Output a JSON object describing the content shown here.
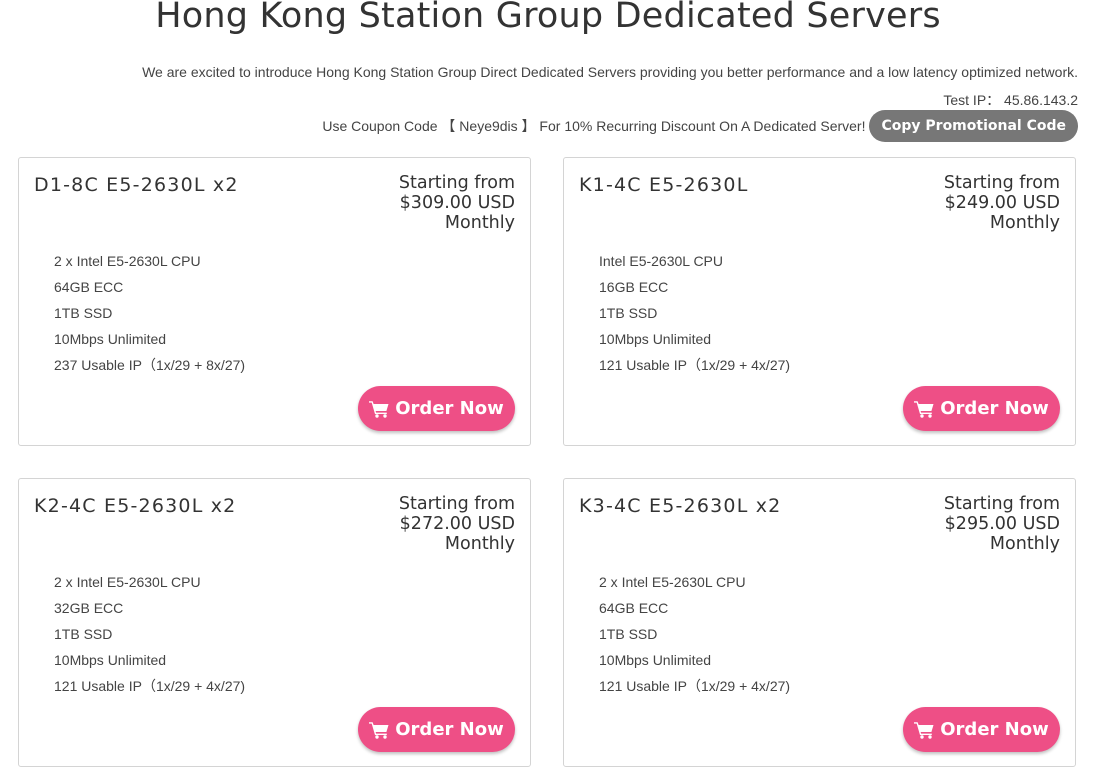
{
  "page": {
    "title": "Hong Kong Station Group Dedicated Servers",
    "intro": "We are excited to introduce Hong Kong Station Group Direct Dedicated Servers providing you better performance and a low latency optimized network.",
    "test_ip": "Test IP： 45.86.143.2",
    "coupon_text": "Use Coupon Code 【 Neye9dis 】 For 10% Recurring Discount On A Dedicated Server!",
    "copy_button_label": "Copy Promotional Code"
  },
  "colors": {
    "order_button": "#ee4f86",
    "copy_button": "#777777"
  },
  "icons": {
    "order_button_icon": "shopping-cart-icon"
  },
  "plans": [
    {
      "name": "D1-8C E5-2630L x2",
      "price_prefix": "Starting from",
      "price": "$309.00 USD",
      "period": "Monthly",
      "specs": [
        "2 x Intel E5-2630L CPU",
        "64GB ECC",
        "1TB SSD",
        "10Mbps Unlimited",
        "237 Usable IP（1x/29 + 8x/27)"
      ],
      "order_label": "Order Now"
    },
    {
      "name": "K1-4C E5-2630L",
      "price_prefix": "Starting from",
      "price": "$249.00 USD",
      "period": "Monthly",
      "specs": [
        "Intel E5-2630L CPU",
        "16GB ECC",
        "1TB SSD",
        "10Mbps Unlimited",
        "121 Usable IP（1x/29 + 4x/27)"
      ],
      "order_label": "Order Now"
    },
    {
      "name": "K2-4C E5-2630L x2",
      "price_prefix": "Starting from",
      "price": "$272.00 USD",
      "period": "Monthly",
      "specs": [
        "2 x Intel E5-2630L CPU",
        "32GB ECC",
        "1TB SSD",
        "10Mbps Unlimited",
        "121 Usable IP（1x/29 + 4x/27)"
      ],
      "order_label": "Order Now"
    },
    {
      "name": "K3-4C E5-2630L x2",
      "price_prefix": "Starting from",
      "price": "$295.00 USD",
      "period": "Monthly",
      "specs": [
        "2 x Intel E5-2630L CPU",
        "64GB ECC",
        "1TB SSD",
        "10Mbps Unlimited",
        "121 Usable IP（1x/29 + 4x/27)"
      ],
      "order_label": "Order Now"
    }
  ]
}
